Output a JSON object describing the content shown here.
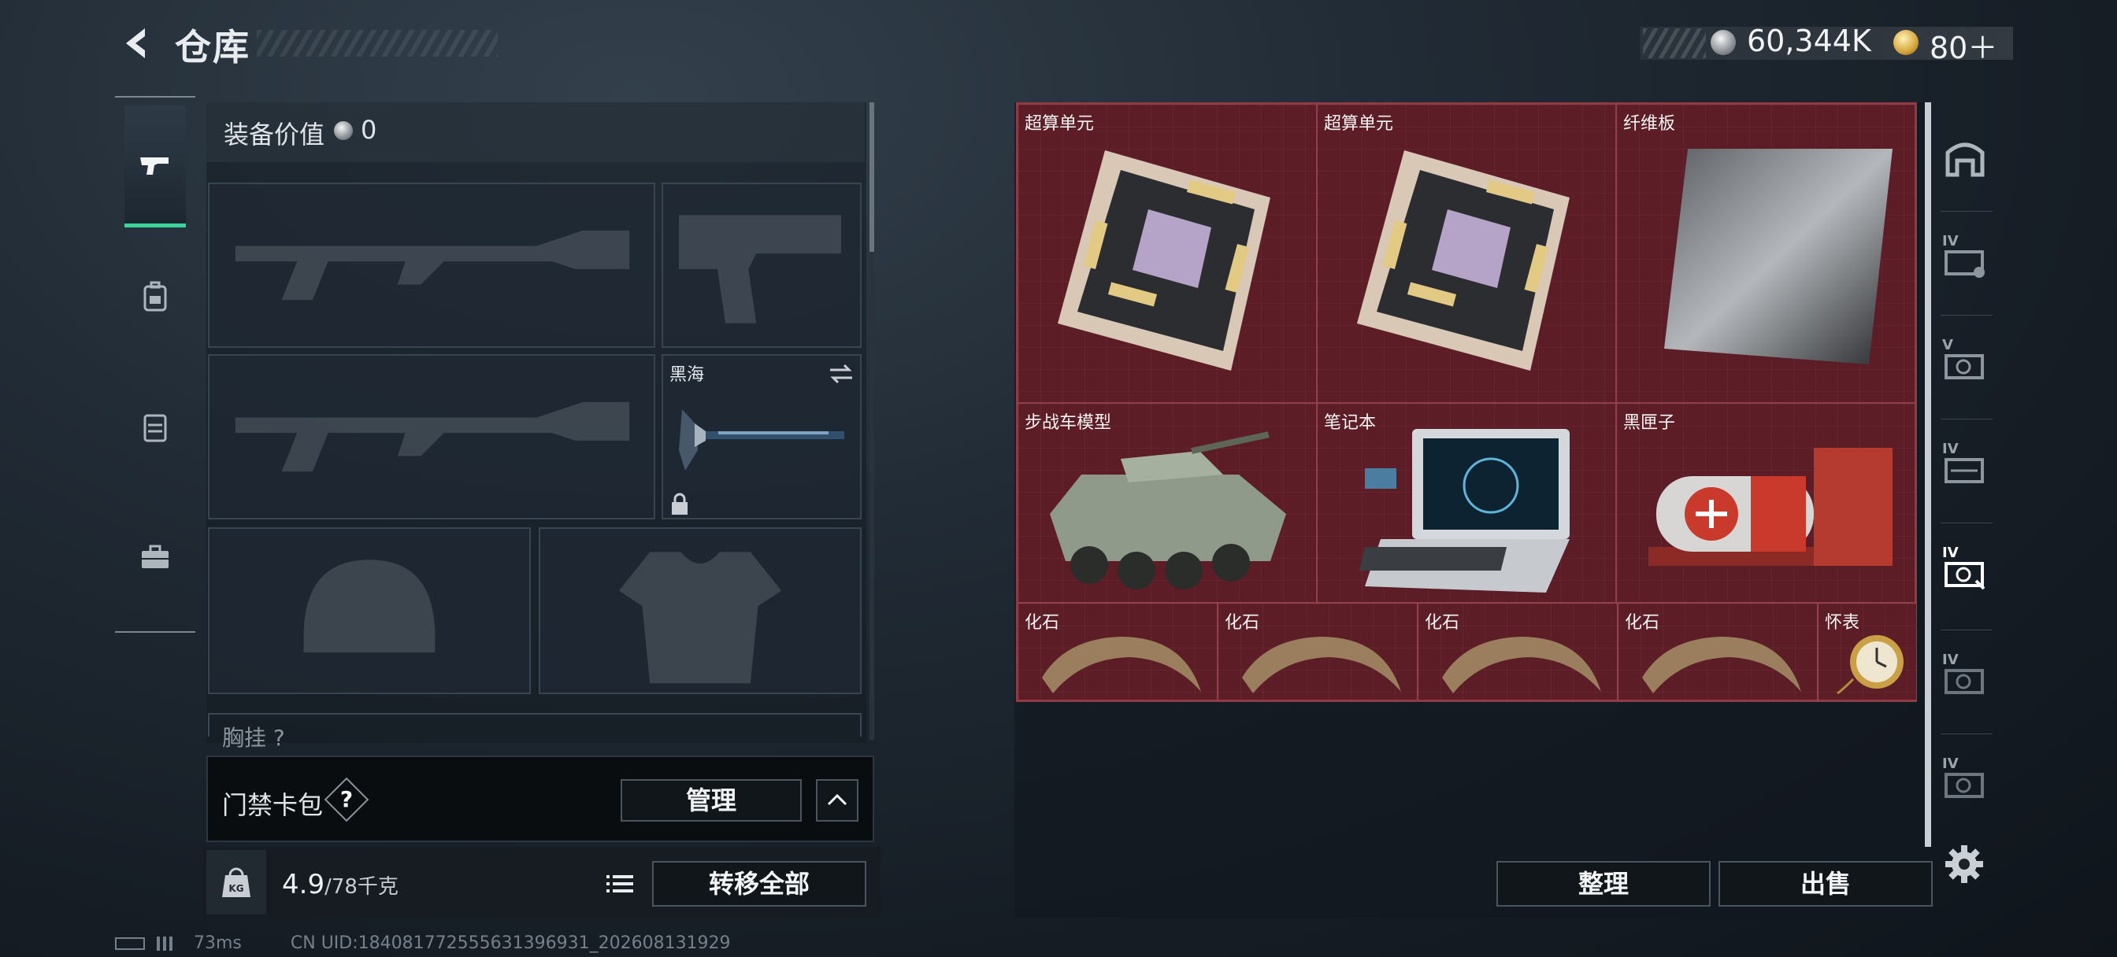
{
  "header": {
    "title": "仓库",
    "currency": [
      {
        "icon": "silver-coin-icon",
        "value": "60,344K"
      },
      {
        "icon": "gold-coin-icon",
        "value": "80＋"
      }
    ]
  },
  "left_rail": {
    "items": [
      {
        "icon": "pistol-icon",
        "active": true
      },
      {
        "icon": "backpack-icon",
        "active": false
      },
      {
        "icon": "vest-icon",
        "active": false
      },
      {
        "icon": "case-icon",
        "active": false
      }
    ]
  },
  "loadout": {
    "value_label": "装备价值",
    "value": "0",
    "melee_name": "黑海",
    "partial_label": "胸挂",
    "partial_value": "?"
  },
  "keycard": {
    "label": "门禁卡包",
    "help": "?",
    "manage_label": "管理"
  },
  "weight": {
    "current": "4.9",
    "max": "/78",
    "unit": "千克",
    "transfer_label": "转移全部"
  },
  "storage": {
    "items": [
      {
        "name": "超算单元",
        "icon": "supercomputer-unit-icon"
      },
      {
        "name": "超算单元",
        "icon": "supercomputer-unit-icon"
      },
      {
        "name": "纤维板",
        "icon": "fiber-board-icon"
      },
      {
        "name": "步战车模型",
        "icon": "ifv-model-icon"
      },
      {
        "name": "笔记本",
        "icon": "laptop-icon"
      },
      {
        "name": "黑匣子",
        "icon": "black-box-icon"
      },
      {
        "name": "化石",
        "icon": "fossil-claw-icon"
      },
      {
        "name": "化石",
        "icon": "fossil-claw-icon"
      },
      {
        "name": "化石",
        "icon": "fossil-claw-icon"
      },
      {
        "name": "化石",
        "icon": "fossil-claw-icon"
      },
      {
        "name": "怀表",
        "icon": "pocket-watch-icon"
      }
    ],
    "sort_label": "整理",
    "sell_label": "出售"
  },
  "right_rail": {
    "tiers": [
      "",
      "IV",
      "V",
      "IV",
      "IV",
      "IV",
      "IV"
    ]
  },
  "footer": {
    "ping": "73ms",
    "uid": "CN UID:184081772555631396931_202608131929"
  },
  "colors": {
    "accent": "#3bd39a",
    "grid_bg": "#5c1d26",
    "grid_border": "#8e3a45"
  }
}
